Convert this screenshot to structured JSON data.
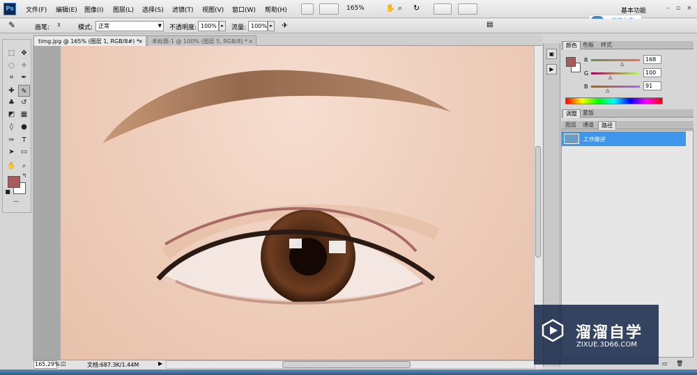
{
  "app": {
    "logo_text": "Ps"
  },
  "menu": [
    "文件(F)",
    "编辑(E)",
    "图像(I)",
    "图层(L)",
    "选择(S)",
    "滤镜(T)",
    "视图(V)",
    "窗口(W)",
    "帮助(H)"
  ],
  "toolbar": {
    "zoom_value": "165%",
    "workspace": "基本功能"
  },
  "upload": {
    "label": "拖拽上传"
  },
  "options_bar": {
    "brush_label": "画笔:",
    "brush_size": "3",
    "mode_label": "模式:",
    "mode_value": "正常",
    "opacity_label": "不透明度:",
    "opacity_value": "100%",
    "flow_label": "流量:",
    "flow_value": "100%"
  },
  "tabs": [
    {
      "label": "timg.jpg @ 165% (图层 1, RGB/8#) *",
      "close": "×",
      "active": true
    },
    {
      "label": "未标题-1 @ 100% (图层 5, RGB/8) *",
      "close": "×",
      "active": false
    }
  ],
  "status": {
    "zoom": "165.29%",
    "doc_info": "文档:687.3K/1.44M"
  },
  "colors": {
    "foreground": "#a85b5b",
    "background": "#ffffff",
    "path_stroke": "#a86a66",
    "selection_blue": "#3d96ea"
  },
  "color_panel": {
    "tabs": [
      "颜色",
      "色板",
      "样式"
    ],
    "r_label": "R",
    "r_value": "168",
    "g_label": "G",
    "g_value": "100",
    "b_label": "B",
    "b_value": "91"
  },
  "adjust_panel": {
    "tabs": [
      "调整",
      "蒙版"
    ]
  },
  "layers_panel": {
    "tabs": [
      "图层",
      "通道",
      "路径"
    ],
    "path_name": "工作路径"
  },
  "watermark": {
    "title": "溜溜自学",
    "url": "ZIXUE.3D66.COM"
  }
}
